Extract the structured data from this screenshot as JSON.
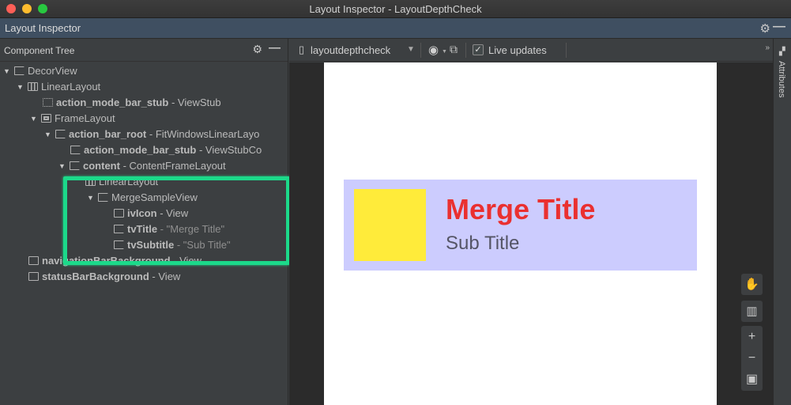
{
  "window": {
    "title": "Layout Inspector - LayoutDepthCheck"
  },
  "toolwindow": {
    "title": "Layout Inspector"
  },
  "component_tree": {
    "title": "Component Tree",
    "rows": [
      {
        "name": "DecorView",
        "type": "",
        "value": ""
      },
      {
        "name": "LinearLayout",
        "type": "",
        "value": ""
      },
      {
        "name": "action_mode_bar_stub",
        "type": "ViewStub",
        "value": ""
      },
      {
        "name": "FrameLayout",
        "type": "",
        "value": ""
      },
      {
        "name": "action_bar_root",
        "type": "FitWindowsLinearLayo",
        "value": ""
      },
      {
        "name": "action_mode_bar_stub",
        "type": "ViewStubCo",
        "value": ""
      },
      {
        "name": "content",
        "type": "ContentFrameLayout",
        "value": ""
      },
      {
        "name": "LinearLayout",
        "type": "",
        "value": ""
      },
      {
        "name": "MergeSampleView",
        "type": "",
        "value": ""
      },
      {
        "name": "ivIcon",
        "type": "View",
        "value": ""
      },
      {
        "name": "tvTitle",
        "type": "",
        "value": "\"Merge Title\""
      },
      {
        "name": "tvSubtitle",
        "type": "",
        "value": "\"Sub Title\""
      },
      {
        "name": "navigationBarBackground",
        "type": "View",
        "value": ""
      },
      {
        "name": "statusBarBackground",
        "type": "View",
        "value": ""
      }
    ]
  },
  "toolbar": {
    "process": "layoutdepthcheck",
    "live_updates_label": "Live updates",
    "live_updates_checked": true
  },
  "preview": {
    "title": "Merge Title",
    "subtitle": "Sub Title",
    "colors": {
      "title": "#ea3030",
      "card": "#ccccfe",
      "icon": "#ffeb3a",
      "highlight": "#1cd98a"
    }
  },
  "attributes": {
    "label": "Attributes"
  }
}
